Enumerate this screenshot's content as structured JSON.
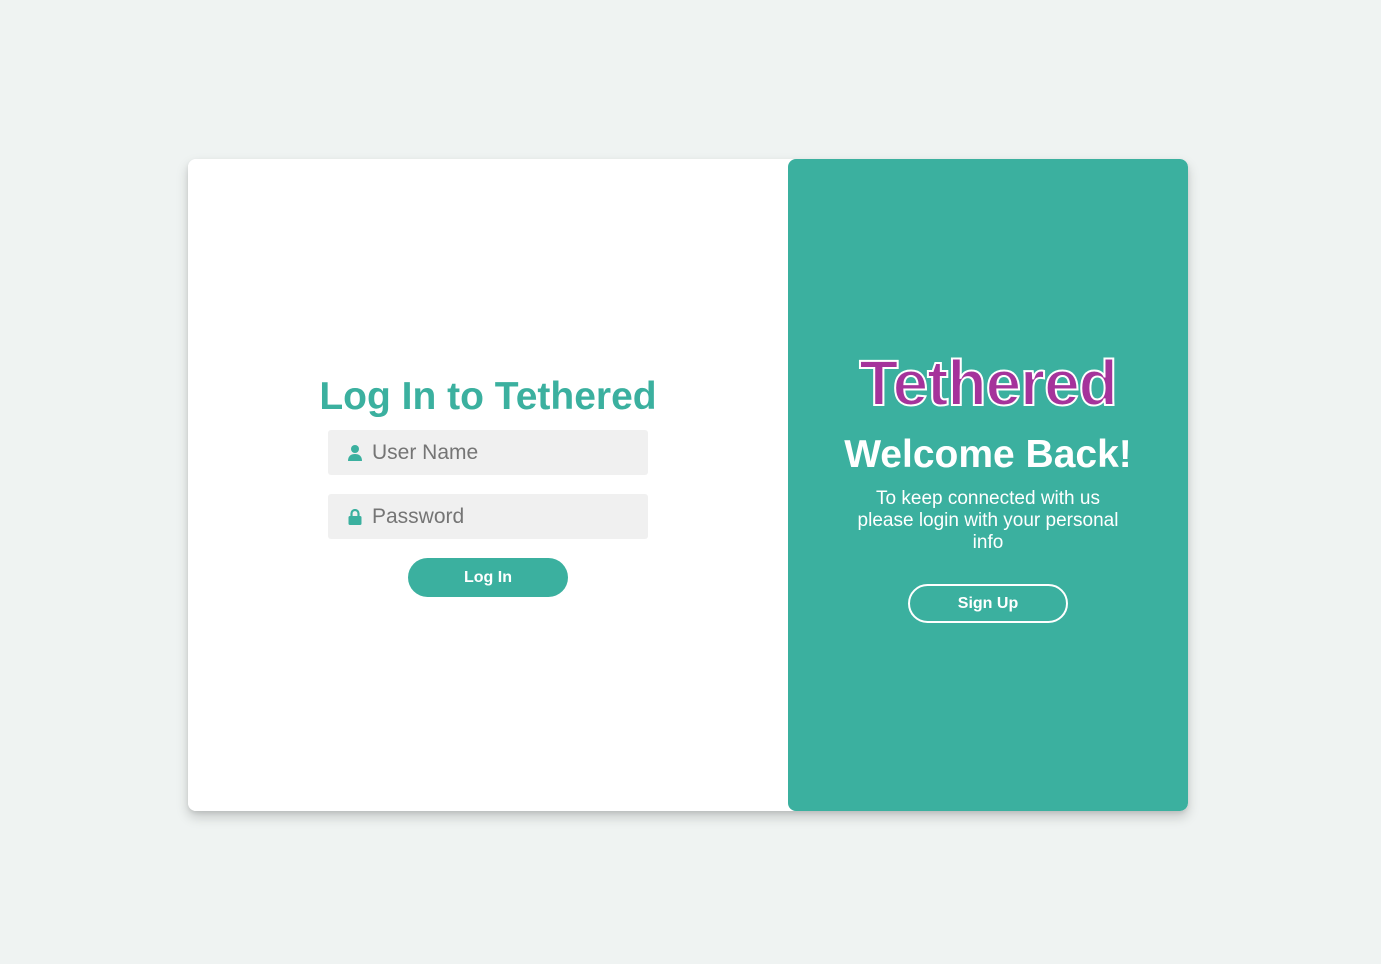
{
  "colors": {
    "background": "#eff3f2",
    "accent": "#3bb09f",
    "brand": "#a5339b",
    "field_bg": "#f0f0f0",
    "white": "#ffffff"
  },
  "login": {
    "title": "Log In to Tethered",
    "username_placeholder": "User Name",
    "username_icon": "user-icon",
    "password_placeholder": "Password",
    "password_icon": "lock-icon",
    "login_button": "Log In"
  },
  "welcome_panel": {
    "brand": "Tethered",
    "heading": "Welcome Back!",
    "message": "To keep connected with us please login with your personal info",
    "signup_button": "Sign Up"
  }
}
